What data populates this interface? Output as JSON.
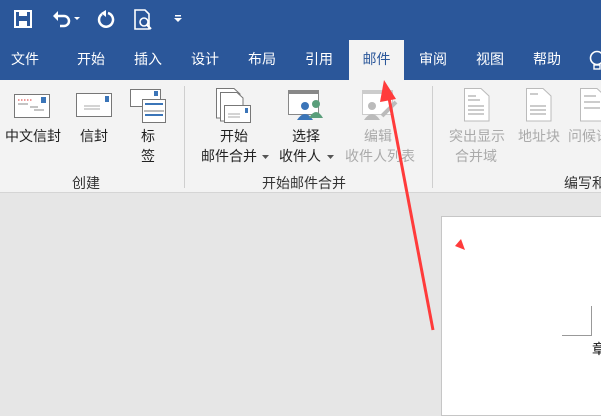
{
  "quick_access": {
    "save": "save-icon",
    "undo": "undo-icon",
    "redo": "redo-icon",
    "preview": "print-preview-icon",
    "customize": "customize-icon"
  },
  "tabs": [
    {
      "label": "文件"
    },
    {
      "label": "开始"
    },
    {
      "label": "插入"
    },
    {
      "label": "设计"
    },
    {
      "label": "布局"
    },
    {
      "label": "引用"
    },
    {
      "label": "邮件",
      "active": true
    },
    {
      "label": "审阅"
    },
    {
      "label": "视图"
    },
    {
      "label": "帮助"
    }
  ],
  "ribbon": {
    "groups": [
      {
        "label": "创建",
        "buttons": [
          {
            "label": "中文信封"
          },
          {
            "label": "信封"
          },
          {
            "label": "标",
            "label2": "签"
          }
        ]
      },
      {
        "label": "开始邮件合并",
        "buttons": [
          {
            "label": "开始",
            "label2": "邮件合并"
          },
          {
            "label": "选择",
            "label2": "收件人"
          },
          {
            "label": "编辑",
            "label2": "收件人列表",
            "disabled": true
          }
        ]
      },
      {
        "label": "编写和",
        "buttons": [
          {
            "label": "突出显示",
            "label2": "合并域",
            "disabled": true
          },
          {
            "label": "地址块",
            "disabled": true
          },
          {
            "label": "问候语",
            "disabled": true
          }
        ]
      }
    ]
  },
  "document": {
    "partial_char": "章"
  },
  "colors": {
    "brand": "#2b579a",
    "annotation": "#ff3b3b"
  }
}
